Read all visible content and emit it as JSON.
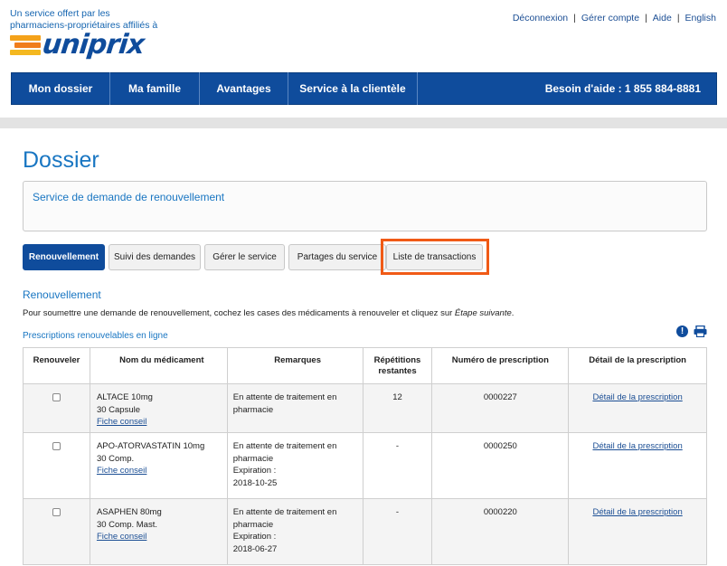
{
  "header": {
    "tagline": "Un service offert par les pharmaciens-propriétaires affiliés à",
    "logo_text": "uniprix",
    "links": [
      "Déconnexion",
      "Gérer compte",
      "Aide",
      "English"
    ]
  },
  "nav": {
    "items": [
      "Mon dossier",
      "Ma famille",
      "Avantages",
      "Service à la clientèle"
    ],
    "help": "Besoin d'aide : 1 855 884-8881"
  },
  "page": {
    "title": "Dossier",
    "service_box": "Service de demande de renouvellement"
  },
  "tabs": [
    "Renouvellement",
    "Suivi des demandes",
    "Gérer le service",
    "Partages du service",
    "Liste de transactions"
  ],
  "section": {
    "title": "Renouvellement",
    "instructions": "Pour soumettre une demande de renouvellement, cochez les cases des médicaments à renouveler et cliquez sur ",
    "instructions_em": "Étape suivante",
    "instructions_end": ".",
    "sub_title": "Prescriptions renouvelables en ligne"
  },
  "table": {
    "headers": [
      "Renouveler",
      "Nom du médicament",
      "Remarques",
      "Répétitions restantes",
      "Numéro de prescription",
      "Détail de la prescription"
    ],
    "rows": [
      {
        "name": "ALTACE 10mg",
        "form": "30 Capsule",
        "advice": "Fiche conseil",
        "remark": "En attente de traitement en pharmacie",
        "expiration_label": "",
        "expiration": "",
        "repeats": "12",
        "number": "0000227",
        "detail": "Détail de la prescription"
      },
      {
        "name": "APO-ATORVASTATIN 10mg",
        "form": "30 Comp.",
        "advice": "Fiche conseil",
        "remark": "En attente de traitement en pharmacie",
        "expiration_label": "Expiration :",
        "expiration": "2018-10-25",
        "repeats": "-",
        "number": "0000250",
        "detail": "Détail de la prescription"
      },
      {
        "name": "ASAPHEN 80mg",
        "form": "30 Comp. Mast.",
        "advice": "Fiche conseil",
        "remark": "En attente de traitement en pharmacie",
        "expiration_label": "Expiration :",
        "expiration": "2018-06-27",
        "repeats": "-",
        "number": "0000220",
        "detail": "Détail de la prescription"
      }
    ]
  },
  "colors": {
    "brand_blue": "#0f4c9c",
    "link_blue": "#1976c2",
    "highlight": "#f05a16",
    "logo_orange": "#f4a21a"
  }
}
